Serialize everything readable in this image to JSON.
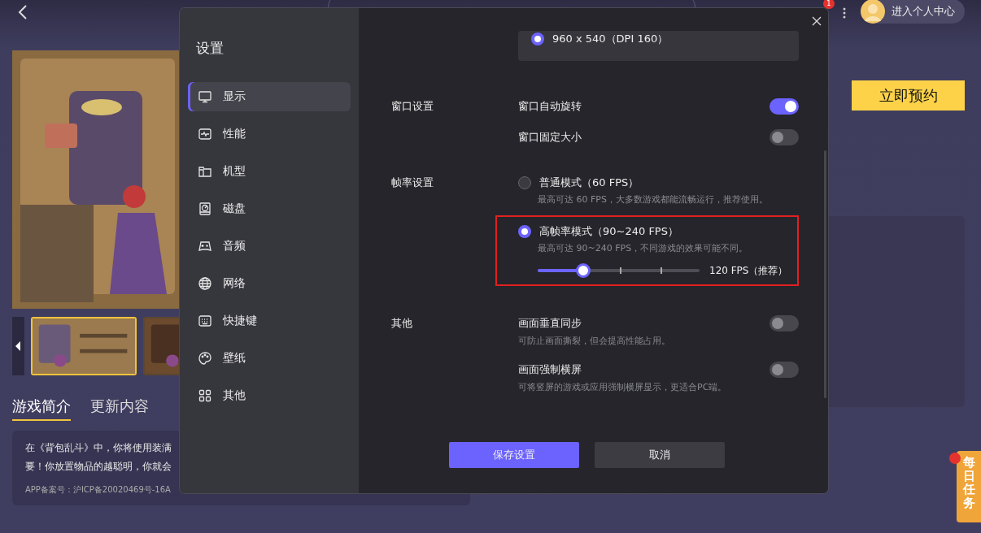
{
  "topbar": {
    "notification_count": "1",
    "profile_label": "进入个人中心"
  },
  "thumbnails": [
    {
      "selected": true
    },
    {
      "selected": false
    }
  ],
  "tabs": [
    {
      "label": "游戏简介",
      "selected": true
    },
    {
      "label": "更新内容",
      "selected": false
    }
  ],
  "description": {
    "lines": [
      "在《背包乱斗》中，你将使用装满",
      "要！你放置物品的越聪明，你就会"
    ],
    "record": "APP备案号：沪ICP备20020469号-16A"
  },
  "reserve_button": "立即预约",
  "daily_task": "每日任务",
  "dialog": {
    "title": "设置",
    "nav": [
      {
        "label": "显示",
        "selected": true
      },
      {
        "label": "性能",
        "selected": false
      },
      {
        "label": "机型",
        "selected": false
      },
      {
        "label": "磁盘",
        "selected": false
      },
      {
        "label": "音频",
        "selected": false
      },
      {
        "label": "网络",
        "selected": false
      },
      {
        "label": "快捷键",
        "selected": false
      },
      {
        "label": "壁纸",
        "selected": false
      },
      {
        "label": "其他",
        "selected": false
      }
    ],
    "resolution": {
      "label": "960 x 540（DPI 160）",
      "selected": true
    },
    "sections": [
      {
        "label": "窗口设置",
        "items": [
          {
            "kind": "toggle",
            "label": "窗口自动旋转",
            "on": true
          },
          {
            "kind": "toggle",
            "label": "窗口固定大小",
            "on": false
          }
        ]
      },
      {
        "label": "帧率设置",
        "items": [
          {
            "kind": "radio",
            "label": "普通模式（60 FPS）",
            "hint": "最高可达 60 FPS，大多数游戏都能流畅运行，推荐使用。",
            "selected": false,
            "highlighted": false
          },
          {
            "kind": "radio",
            "label": "高帧率模式（90~240 FPS）",
            "hint": "最高可达 90~240 FPS，不同游戏的效果可能不同。",
            "selected": true,
            "highlighted": true,
            "slider": {
              "level": 0.28,
              "reading": "120 FPS（推荐）"
            }
          }
        ]
      },
      {
        "label": "其他",
        "items": [
          {
            "kind": "toggle",
            "label": "画面垂直同步",
            "hint": "可防止画面撕裂，但会提高性能占用。",
            "on": false
          },
          {
            "kind": "toggle",
            "label": "画面强制横屏",
            "hint": "可将竖屏的游戏或应用强制横屏显示，更适合PC端。",
            "on": false
          }
        ]
      }
    ],
    "buttons": [
      {
        "label": "保存设置",
        "kind": "primary"
      },
      {
        "label": "取消",
        "kind": "secondary"
      }
    ]
  }
}
